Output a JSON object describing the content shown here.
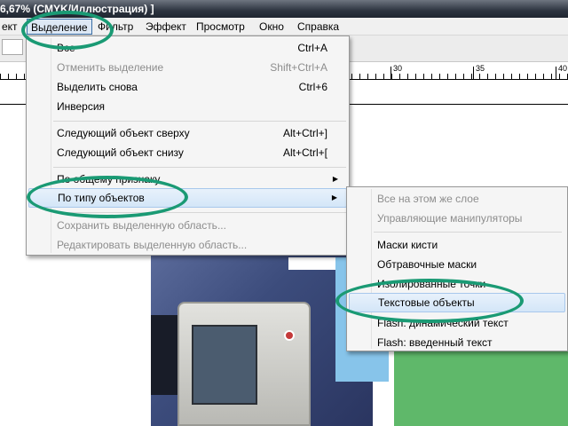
{
  "window": {
    "title": "6,67% (CMYK/Иллюстрация) ]"
  },
  "menubar": {
    "items": [
      {
        "label": "ект"
      },
      {
        "label": "Выделение"
      },
      {
        "label": "Фильтр"
      },
      {
        "label": "Эффект"
      },
      {
        "label": "Просмотр"
      },
      {
        "label": "Окно"
      },
      {
        "label": "Справка"
      }
    ]
  },
  "ruler": {
    "labels": [
      "30",
      "35",
      "40"
    ]
  },
  "selection_menu": {
    "items": [
      {
        "label": "Все",
        "shortcut": "Ctrl+A"
      },
      {
        "label": "Отменить выделение",
        "shortcut": "Shift+Ctrl+A"
      },
      {
        "label": "Выделить снова",
        "shortcut": "Ctrl+6"
      },
      {
        "label": "Инверсия",
        "shortcut": ""
      },
      {
        "label": "Следующий объект сверху",
        "shortcut": "Alt+Ctrl+]"
      },
      {
        "label": "Следующий объект снизу",
        "shortcut": "Alt+Ctrl+["
      },
      {
        "label": "По общему признаку",
        "shortcut": ""
      },
      {
        "label": "По типу объектов",
        "shortcut": ""
      },
      {
        "label": "Сохранить выделенную область...",
        "shortcut": ""
      },
      {
        "label": "Редактировать выделенную область...",
        "shortcut": ""
      }
    ]
  },
  "object_type_submenu": {
    "items": [
      {
        "label": "Все на этом же слое"
      },
      {
        "label": "Управляющие манипуляторы"
      },
      {
        "label": "Маски кисти"
      },
      {
        "label": "Обтравочные маски"
      },
      {
        "label": "Изолированные точки"
      },
      {
        "label": "Текстовые объекты"
      },
      {
        "label": "Flash: динамический текст"
      },
      {
        "label": "Flash: введенный текст"
      }
    ]
  },
  "colors": {
    "annotation_ring": "#1a9a74",
    "highlight": "#d4e6f8",
    "disabled_text": "#8d8d8d"
  }
}
